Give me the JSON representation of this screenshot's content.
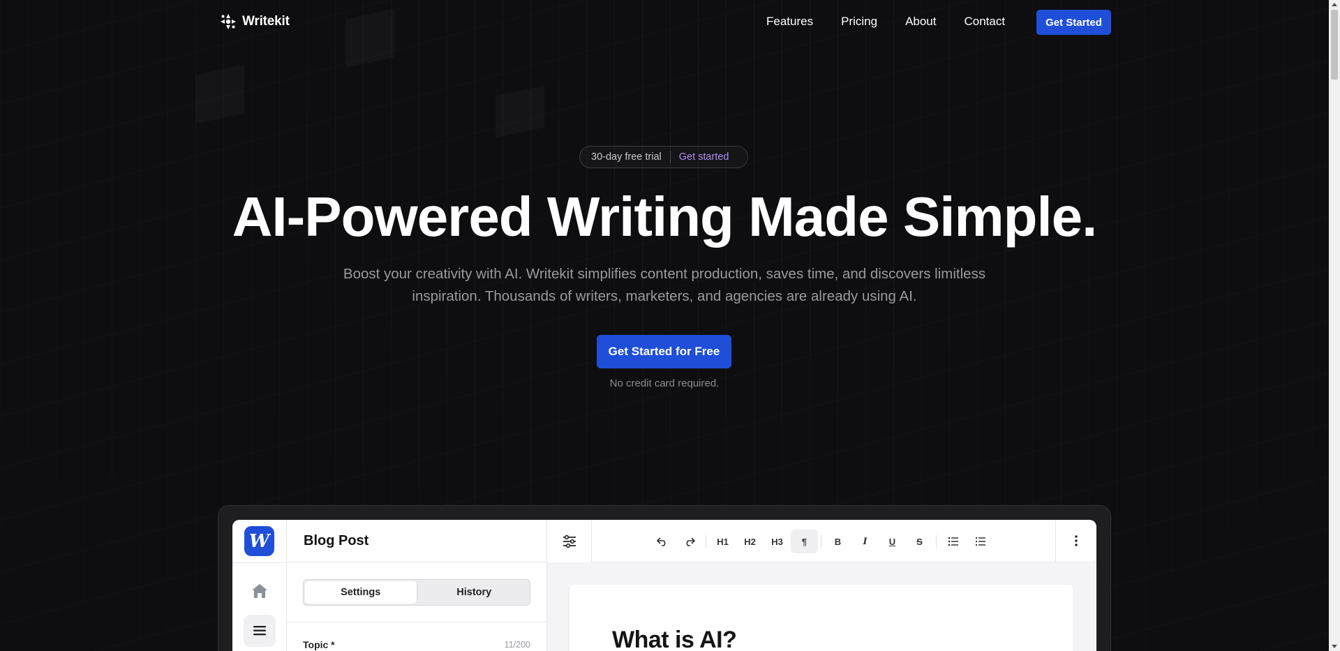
{
  "nav": {
    "brand": "Writekit",
    "links": [
      "Features",
      "Pricing",
      "About",
      "Contact"
    ],
    "cta": "Get Started"
  },
  "hero": {
    "badge_left": "30-day free trial",
    "badge_right": "Get started",
    "title": "AI-Powered Writing Made Simple.",
    "subtitle": "Boost your creativity with AI. Writekit simplifies content production, saves time, and discovers limitless inspiration. Thousands of writers, marketers, and agencies are already using AI.",
    "cta": "Get Started for Free",
    "note": "No credit card required."
  },
  "app": {
    "logo_glyph": "W",
    "panel_title": "Blog Post",
    "tabs": [
      "Settings",
      "History"
    ],
    "active_tab": "Settings",
    "topic_label": "Topic *",
    "topic_count": "11/200",
    "toolbar": {
      "h1": "H1",
      "h2": "H2",
      "h3": "H3",
      "paragraph": "¶",
      "bold": "B",
      "italic": "I",
      "underline": "U",
      "strike": "S"
    },
    "doc_heading": "What is AI?"
  },
  "colors": {
    "background": "#0e0e10",
    "accent": "#1f4fd8",
    "badge_link": "#b48cf2"
  },
  "icons": [
    "brand-logo-icon",
    "home-icon",
    "document-icon",
    "sliders-icon",
    "undo-icon",
    "redo-icon",
    "bullet-list-icon",
    "numbered-list-icon",
    "more-vertical-icon"
  ]
}
